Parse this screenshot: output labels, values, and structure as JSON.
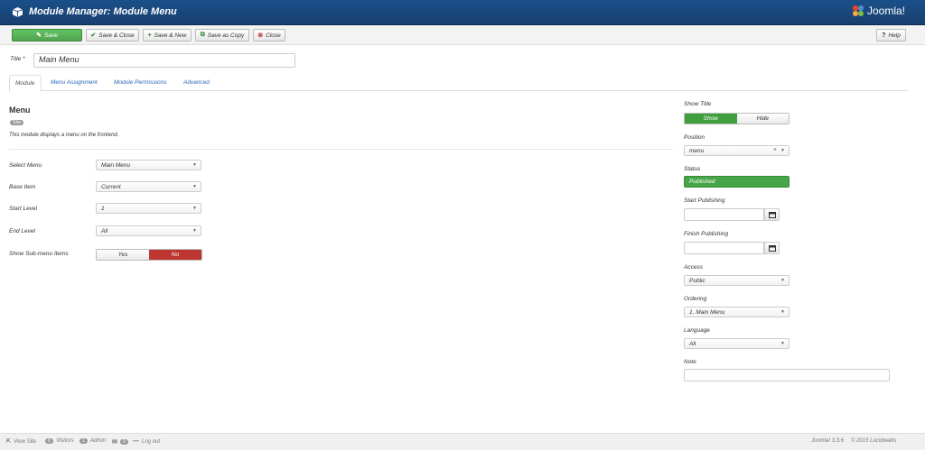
{
  "header": {
    "title": "Module Manager: Module Menu",
    "logo": "Joomla!"
  },
  "toolbar": {
    "save": "Save",
    "save_close": "Save & Close",
    "save_new": "Save & New",
    "save_copy": "Save as Copy",
    "close": "Close",
    "help": "Help"
  },
  "form": {
    "title_label": "Title",
    "title_required": "*",
    "title_value": "Main Menu"
  },
  "tabs": [
    "Module",
    "Menu Assignment",
    "Module Permissions",
    "Advanced"
  ],
  "module": {
    "heading": "Menu",
    "badge": "Site",
    "description": "This module displays a menu on the frontend."
  },
  "fields": {
    "select_menu": {
      "label": "Select Menu",
      "value": "Main Menu"
    },
    "base_item": {
      "label": "Base Item",
      "value": "Current"
    },
    "start_level": {
      "label": "Start Level",
      "value": "1"
    },
    "end_level": {
      "label": "End Level",
      "value": "All"
    },
    "show_sub": {
      "label": "Show Sub-menu Items",
      "yes": "Yes",
      "no": "No"
    }
  },
  "side": {
    "show_title": {
      "label": "Show Title",
      "show": "Show",
      "hide": "Hide"
    },
    "position": {
      "label": "Position",
      "value": "menu"
    },
    "status": {
      "label": "Status",
      "value": "Published"
    },
    "start_publishing": {
      "label": "Start Publishing",
      "value": ""
    },
    "finish_publishing": {
      "label": "Finish Publishing",
      "value": ""
    },
    "access": {
      "label": "Access",
      "value": "Public"
    },
    "ordering": {
      "label": "Ordering",
      "value": "1. Main Menu"
    },
    "language": {
      "label": "Language",
      "value": "All"
    },
    "note": {
      "label": "Note",
      "value": ""
    }
  },
  "footer": {
    "view_site": "View Site",
    "visitors_count": "0",
    "visitors": "Visitors",
    "admin_count": "1",
    "admin": "Admin",
    "messages_count": "0",
    "logout": "Log out",
    "version": "Joomla! 3.3.6",
    "copyright": "© 2015 Lucidwalks"
  },
  "colors": {
    "header": "#1b4f8a",
    "green": "#46a546",
    "red": "#bd362f",
    "link": "#2a69b8"
  }
}
